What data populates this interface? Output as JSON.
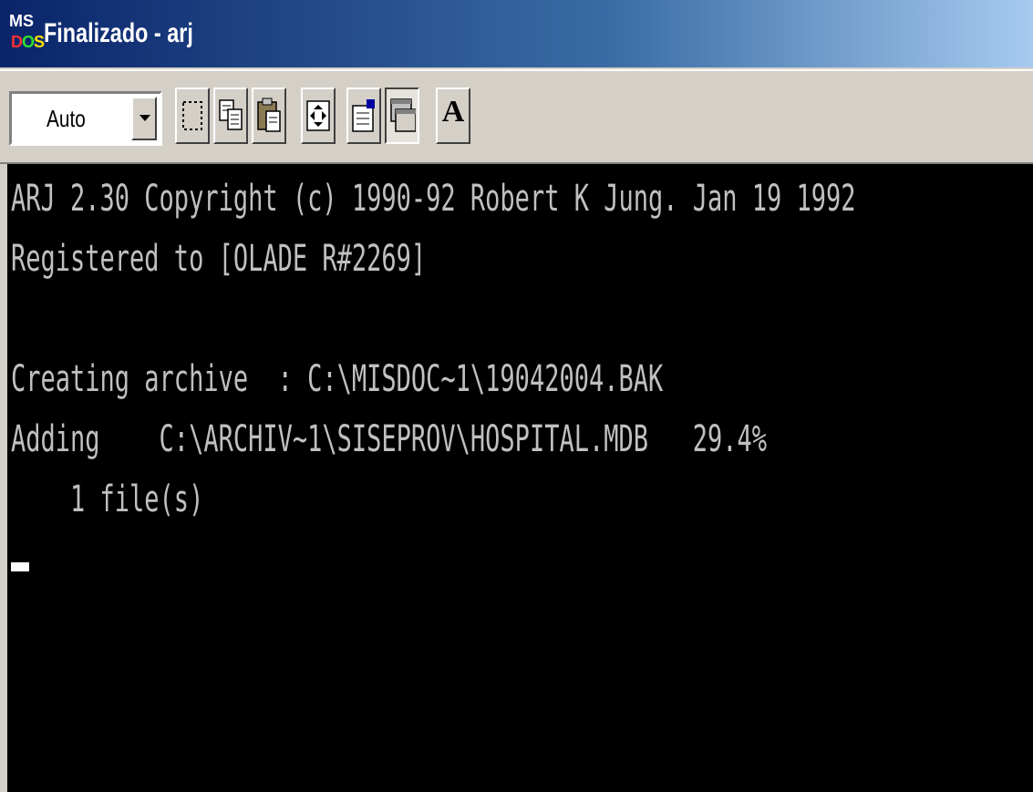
{
  "window": {
    "title": "Finalizado - arj",
    "icon": "ms-dos-icon"
  },
  "toolbar": {
    "font_size_value": "Auto",
    "buttons": [
      {
        "icon": "mark-icon"
      },
      {
        "icon": "copy-icon"
      },
      {
        "icon": "paste-icon"
      },
      {
        "icon": "fullscreen-icon"
      },
      {
        "icon": "properties-icon"
      },
      {
        "icon": "background-icon"
      },
      {
        "icon": "font-icon",
        "label": "A"
      }
    ]
  },
  "console": {
    "lines": [
      "ARJ 2.30 Copyright (c) 1990-92 Robert K Jung. Jan 19 1992",
      "Registered to [OLADE R#2269]",
      "",
      "Creating archive  : C:\\MISDOC~1\\19042004.BAK",
      "Adding    C:\\ARCHIV~1\\SISEPROV\\HOSPITAL.MDB   29.4%",
      "    1 file(s)"
    ]
  },
  "colors": {
    "titlebar_start": "#0a246a",
    "titlebar_end": "#a6caf0",
    "face": "#d4d0c8",
    "console_bg": "#000000",
    "console_fg": "#c0c0c0"
  }
}
